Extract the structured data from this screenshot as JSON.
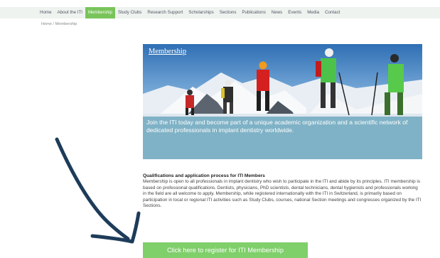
{
  "nav": {
    "items": [
      "Home",
      "About the ITI",
      "Membership",
      "Study Clubs",
      "Research Support",
      "Scholarships",
      "Sections",
      "Publications",
      "News",
      "Events",
      "Media",
      "Contact"
    ],
    "active_index": 2
  },
  "breadcrumb": "Home / Membership",
  "hero": {
    "title": "Membership",
    "caption": "Join the ITI today and become part of a unique academic organization and a scientific network of dedicated professionals in implant dentistry worldwide."
  },
  "content": {
    "heading": "Qualifications and application process for ITI Members",
    "body": "Membership is open to all professionals in implant dentistry who wish to participate in the ITI and abide by its principles. ITI membership is based on professional qualifications. Dentists, physicians, PhD scientists, dental technicians, dental hygienists and professionals working in the field are all welcome to apply. Membership, while registered internationally with the ITI in Switzerland, is primarily based on participation in local or regional ITI activities such as Study Clubs, courses, national Section meetings and congresses organized by the ITI Sections."
  },
  "cta_label": "Click here to register for ITI Membership",
  "colors": {
    "nav_active": "#79c45a",
    "hero_band": "#7fb2c6",
    "cta": "#7fcf6a",
    "arrow": "#1d3c5a"
  },
  "icons": {
    "arrow": "hand-drawn-arrow-icon"
  }
}
